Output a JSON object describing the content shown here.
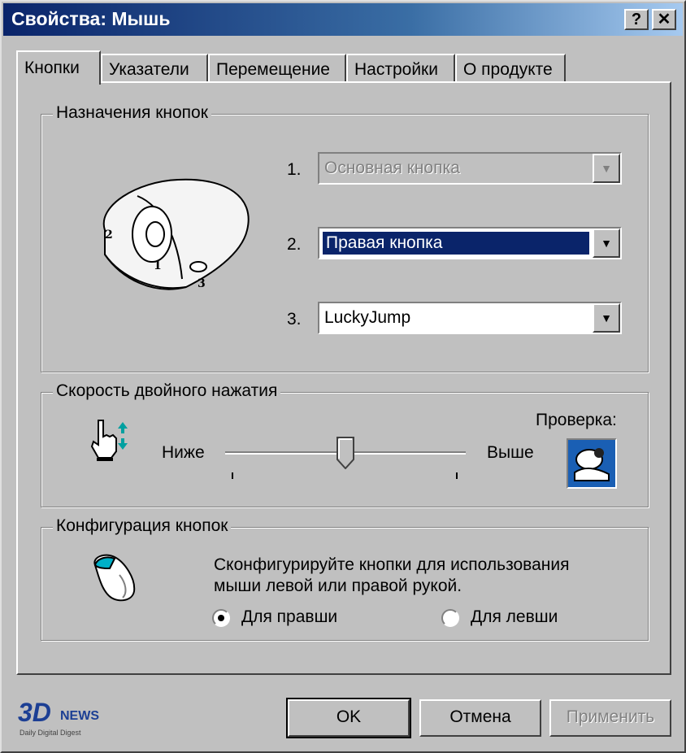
{
  "window": {
    "title": "Свойства: Мышь",
    "help_label": "?",
    "close_label": "✕"
  },
  "tabs": [
    "Кнопки",
    "Указатели",
    "Перемещение",
    "Настройки",
    "О продукте"
  ],
  "active_tab": 0,
  "buttons_group": {
    "label": "Назначения кнопок",
    "mouse_labels": [
      "1",
      "2",
      "3"
    ],
    "assignments": [
      {
        "num": "1.",
        "value": "Основная кнопка",
        "state": "disabled"
      },
      {
        "num": "2.",
        "value": "Правая кнопка",
        "state": "selected"
      },
      {
        "num": "3.",
        "value": "LuckyJump",
        "state": "normal"
      }
    ]
  },
  "speed_group": {
    "label": "Скорость двойного нажатия",
    "low_label": "Ниже",
    "high_label": "Выше",
    "test_label": "Проверка:",
    "slider_value_fraction": 0.5
  },
  "config_group": {
    "label": "Конфигурация кнопок",
    "description_line1": "Сконфигурируйте кнопки для использования",
    "description_line2": "мыши левой или правой рукой.",
    "right_hand_label": "Для правши",
    "left_hand_label": "Для левши",
    "selected": "right"
  },
  "footer": {
    "logo_text": "3D",
    "logo_suffix": "NEWS",
    "logo_tagline": "Daily Digital Digest",
    "ok_label": "OK",
    "cancel_label": "Отмена",
    "apply_label": "Применить"
  },
  "colors": {
    "title_bg": "#0a246a",
    "selection": "#0a246a",
    "face": "#c0c0c0"
  }
}
